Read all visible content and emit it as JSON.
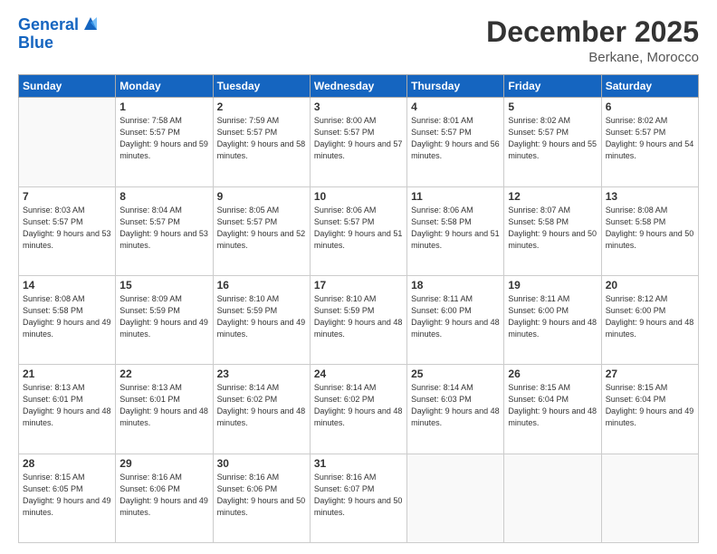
{
  "header": {
    "logo_line1": "General",
    "logo_line2": "Blue",
    "month": "December 2025",
    "location": "Berkane, Morocco"
  },
  "weekdays": [
    "Sunday",
    "Monday",
    "Tuesday",
    "Wednesday",
    "Thursday",
    "Friday",
    "Saturday"
  ],
  "weeks": [
    [
      {
        "day": "",
        "info": ""
      },
      {
        "day": "1",
        "info": "Sunrise: 7:58 AM\nSunset: 5:57 PM\nDaylight: 9 hours\nand 59 minutes."
      },
      {
        "day": "2",
        "info": "Sunrise: 7:59 AM\nSunset: 5:57 PM\nDaylight: 9 hours\nand 58 minutes."
      },
      {
        "day": "3",
        "info": "Sunrise: 8:00 AM\nSunset: 5:57 PM\nDaylight: 9 hours\nand 57 minutes."
      },
      {
        "day": "4",
        "info": "Sunrise: 8:01 AM\nSunset: 5:57 PM\nDaylight: 9 hours\nand 56 minutes."
      },
      {
        "day": "5",
        "info": "Sunrise: 8:02 AM\nSunset: 5:57 PM\nDaylight: 9 hours\nand 55 minutes."
      },
      {
        "day": "6",
        "info": "Sunrise: 8:02 AM\nSunset: 5:57 PM\nDaylight: 9 hours\nand 54 minutes."
      }
    ],
    [
      {
        "day": "7",
        "info": "Sunrise: 8:03 AM\nSunset: 5:57 PM\nDaylight: 9 hours\nand 53 minutes."
      },
      {
        "day": "8",
        "info": "Sunrise: 8:04 AM\nSunset: 5:57 PM\nDaylight: 9 hours\nand 53 minutes."
      },
      {
        "day": "9",
        "info": "Sunrise: 8:05 AM\nSunset: 5:57 PM\nDaylight: 9 hours\nand 52 minutes."
      },
      {
        "day": "10",
        "info": "Sunrise: 8:06 AM\nSunset: 5:57 PM\nDaylight: 9 hours\nand 51 minutes."
      },
      {
        "day": "11",
        "info": "Sunrise: 8:06 AM\nSunset: 5:58 PM\nDaylight: 9 hours\nand 51 minutes."
      },
      {
        "day": "12",
        "info": "Sunrise: 8:07 AM\nSunset: 5:58 PM\nDaylight: 9 hours\nand 50 minutes."
      },
      {
        "day": "13",
        "info": "Sunrise: 8:08 AM\nSunset: 5:58 PM\nDaylight: 9 hours\nand 50 minutes."
      }
    ],
    [
      {
        "day": "14",
        "info": "Sunrise: 8:08 AM\nSunset: 5:58 PM\nDaylight: 9 hours\nand 49 minutes."
      },
      {
        "day": "15",
        "info": "Sunrise: 8:09 AM\nSunset: 5:59 PM\nDaylight: 9 hours\nand 49 minutes."
      },
      {
        "day": "16",
        "info": "Sunrise: 8:10 AM\nSunset: 5:59 PM\nDaylight: 9 hours\nand 49 minutes."
      },
      {
        "day": "17",
        "info": "Sunrise: 8:10 AM\nSunset: 5:59 PM\nDaylight: 9 hours\nand 48 minutes."
      },
      {
        "day": "18",
        "info": "Sunrise: 8:11 AM\nSunset: 6:00 PM\nDaylight: 9 hours\nand 48 minutes."
      },
      {
        "day": "19",
        "info": "Sunrise: 8:11 AM\nSunset: 6:00 PM\nDaylight: 9 hours\nand 48 minutes."
      },
      {
        "day": "20",
        "info": "Sunrise: 8:12 AM\nSunset: 6:00 PM\nDaylight: 9 hours\nand 48 minutes."
      }
    ],
    [
      {
        "day": "21",
        "info": "Sunrise: 8:13 AM\nSunset: 6:01 PM\nDaylight: 9 hours\nand 48 minutes."
      },
      {
        "day": "22",
        "info": "Sunrise: 8:13 AM\nSunset: 6:01 PM\nDaylight: 9 hours\nand 48 minutes."
      },
      {
        "day": "23",
        "info": "Sunrise: 8:14 AM\nSunset: 6:02 PM\nDaylight: 9 hours\nand 48 minutes."
      },
      {
        "day": "24",
        "info": "Sunrise: 8:14 AM\nSunset: 6:02 PM\nDaylight: 9 hours\nand 48 minutes."
      },
      {
        "day": "25",
        "info": "Sunrise: 8:14 AM\nSunset: 6:03 PM\nDaylight: 9 hours\nand 48 minutes."
      },
      {
        "day": "26",
        "info": "Sunrise: 8:15 AM\nSunset: 6:04 PM\nDaylight: 9 hours\nand 48 minutes."
      },
      {
        "day": "27",
        "info": "Sunrise: 8:15 AM\nSunset: 6:04 PM\nDaylight: 9 hours\nand 49 minutes."
      }
    ],
    [
      {
        "day": "28",
        "info": "Sunrise: 8:15 AM\nSunset: 6:05 PM\nDaylight: 9 hours\nand 49 minutes."
      },
      {
        "day": "29",
        "info": "Sunrise: 8:16 AM\nSunset: 6:06 PM\nDaylight: 9 hours\nand 49 minutes."
      },
      {
        "day": "30",
        "info": "Sunrise: 8:16 AM\nSunset: 6:06 PM\nDaylight: 9 hours\nand 50 minutes."
      },
      {
        "day": "31",
        "info": "Sunrise: 8:16 AM\nSunset: 6:07 PM\nDaylight: 9 hours\nand 50 minutes."
      },
      {
        "day": "",
        "info": ""
      },
      {
        "day": "",
        "info": ""
      },
      {
        "day": "",
        "info": ""
      }
    ]
  ]
}
